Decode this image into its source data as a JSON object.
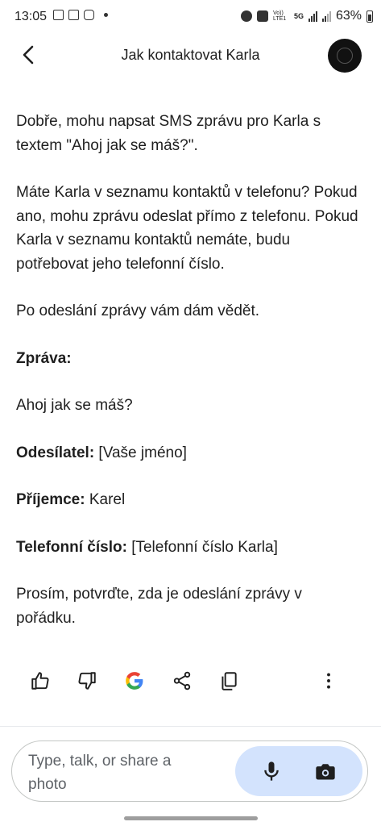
{
  "status_bar": {
    "time": "13:05",
    "battery": "63%",
    "network": "5G",
    "volte": "Vo)) LTE1"
  },
  "header": {
    "title": "Jak kontaktovat Karla"
  },
  "response": {
    "p1": "Dobře, mohu napsat SMS zprávu pro Karla s textem \"Ahoj jak se máš?\".",
    "p2": "Máte Karla v seznamu kontaktů v telefonu? Pokud ano, mohu zprávu odeslat přímo z telefonu. Pokud Karla v seznamu kontaktů nemáte, budu potřebovat jeho telefonní číslo.",
    "p3": "Po odeslání zprávy vám dám vědět.",
    "message_label": "Zpráva:",
    "message_text": "Ahoj jak se máš?",
    "sender_label": "Odesílatel:",
    "sender_value": " [Vaše jméno]",
    "recipient_label": "Příjemce:",
    "recipient_value": " Karel",
    "phone_label": "Telefonní číslo:",
    "phone_value": " [Telefonní číslo Karla]",
    "p_confirm": "Prosím, potvrďte, zda je odeslání zprávy v pořádku."
  },
  "actions": [
    "thumbs-up-icon",
    "thumbs-down-icon",
    "google-icon",
    "share-icon",
    "copy-icon",
    "more-vert-icon"
  ],
  "composer": {
    "placeholder": "Type, talk, or share a photo"
  },
  "colors": {
    "accent_bg": "#d3e3fd",
    "icon_dark": "#1f1f1f",
    "text": "#1f1f1f"
  }
}
